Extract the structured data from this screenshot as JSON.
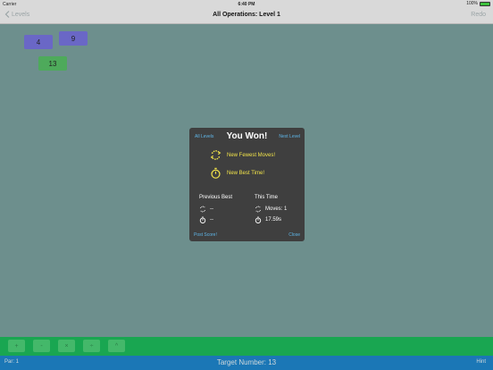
{
  "status_bar": {
    "carrier": "Carrier",
    "time": "6:40 PM",
    "battery": "100%",
    "battery_level": 1.0
  },
  "nav": {
    "back_label": "Levels",
    "title": "All Operations: Level 1",
    "redo_label": "Redo"
  },
  "tiles": [
    {
      "value": "4",
      "color": "#6a67c6"
    },
    {
      "value": "9",
      "color": "#6a67c6"
    },
    {
      "value": "13",
      "color": "#4eaa5b"
    }
  ],
  "modal": {
    "all_levels": "All Levels",
    "title": "You Won!",
    "next_level": "Next Level",
    "award_moves": "New Fewest Moves!",
    "award_time": "New Best Time!",
    "previous_best": {
      "heading": "Previous Best",
      "moves": "--",
      "time": "--"
    },
    "this_time": {
      "heading": "This Time",
      "moves": "Moves: 1",
      "time": "17.59s"
    },
    "post_score": "Post Score!",
    "close": "Close"
  },
  "operations": [
    "+",
    "-",
    "×",
    "÷",
    "^"
  ],
  "footer": {
    "par": "Par: 1",
    "target": "Target Number: 13",
    "hint": "Hint"
  },
  "colors": {
    "background": "#6d8f8d",
    "ops_bar": "#19a651",
    "footer": "#1b77b6",
    "link": "#5fb6e8",
    "award": "#f1e34a"
  }
}
